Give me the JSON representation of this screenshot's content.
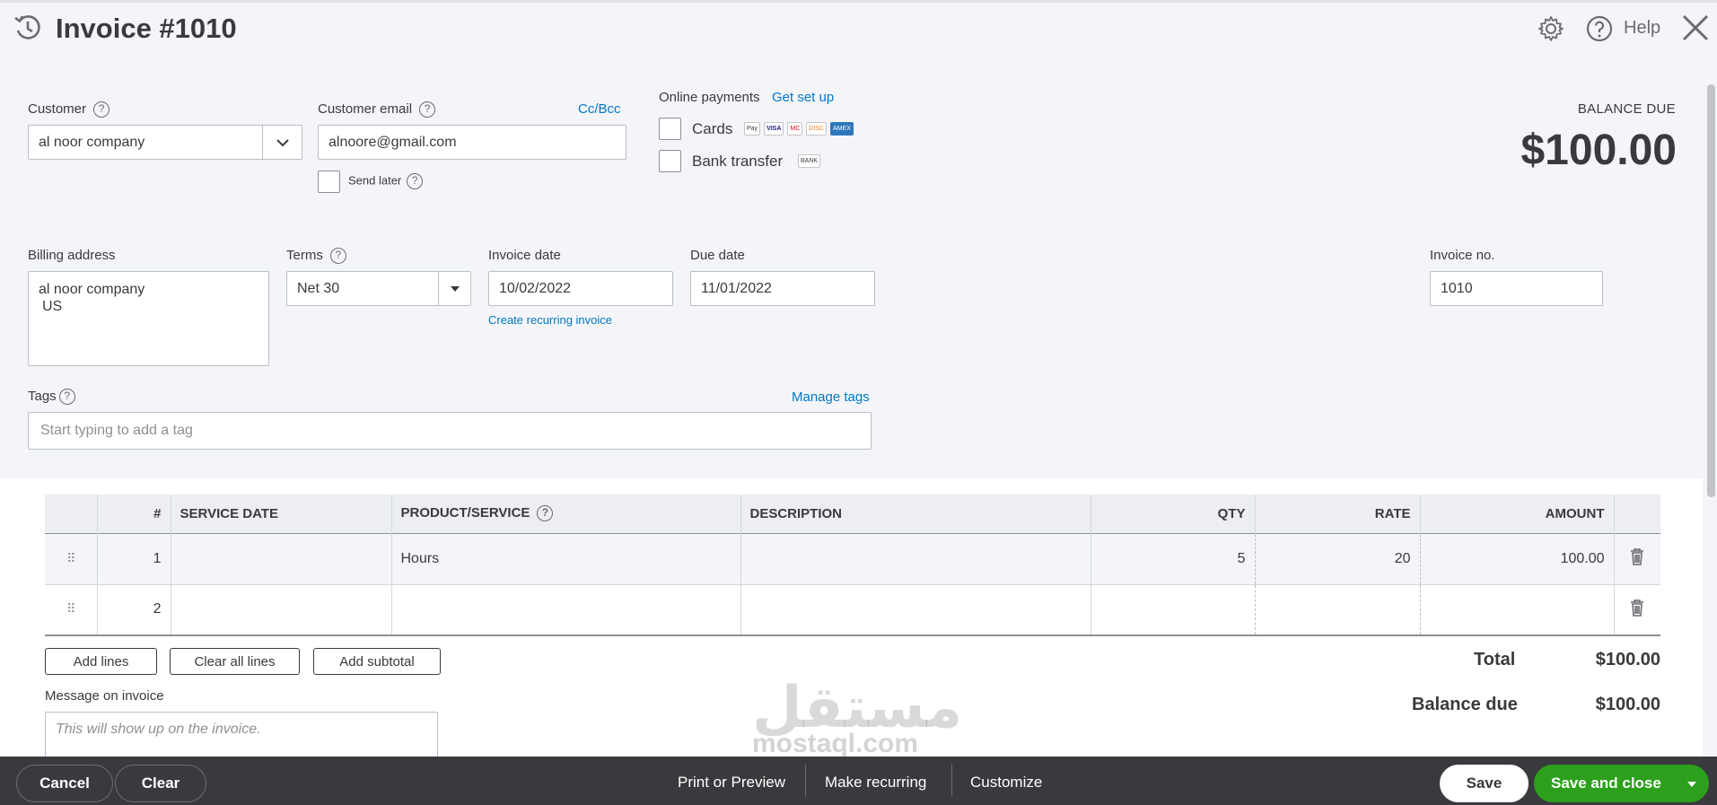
{
  "header": {
    "title": "Invoice #1010",
    "help_label": "Help"
  },
  "customer": {
    "label": "Customer",
    "value": "al noor company"
  },
  "customer_email": {
    "label": "Customer email",
    "value": "alnoore@gmail.com",
    "cc_bcc": "Cc/Bcc",
    "send_later": "Send later"
  },
  "online_payments": {
    "label": "Online payments",
    "setup_link": "Get set up",
    "cards_label": "Cards",
    "bank_label": "Bank transfer",
    "card_badges": [
      "Pay",
      "VISA",
      "MC",
      "DISC",
      "AMEX"
    ],
    "bank_badge": "BANK"
  },
  "balance": {
    "label": "BALANCE DUE",
    "amount": "$100.00"
  },
  "billing": {
    "label": "Billing address",
    "line1": "al noor company",
    "line2": "US"
  },
  "terms": {
    "label": "Terms",
    "value": "Net 30"
  },
  "invoice_date": {
    "label": "Invoice date",
    "value": "10/02/2022",
    "recurring_link": "Create recurring invoice"
  },
  "due_date": {
    "label": "Due date",
    "value": "11/01/2022"
  },
  "invoice_no": {
    "label": "Invoice no.",
    "value": "1010"
  },
  "tags": {
    "label": "Tags",
    "manage_link": "Manage tags",
    "placeholder": "Start typing to add a tag"
  },
  "table": {
    "headers": {
      "num": "#",
      "service_date": "SERVICE DATE",
      "product": "PRODUCT/SERVICE",
      "description": "DESCRIPTION",
      "qty": "QTY",
      "rate": "RATE",
      "amount": "AMOUNT"
    },
    "rows": [
      {
        "num": "1",
        "service_date": "",
        "product": "Hours",
        "description": "",
        "qty": "5",
        "rate": "20",
        "amount": "100.00"
      },
      {
        "num": "2",
        "service_date": "",
        "product": "",
        "description": "",
        "qty": "",
        "rate": "",
        "amount": ""
      }
    ]
  },
  "line_actions": {
    "add_lines": "Add lines",
    "clear_all": "Clear all lines",
    "add_subtotal": "Add subtotal"
  },
  "message": {
    "label": "Message on invoice",
    "placeholder": "This will show up on the invoice."
  },
  "totals": {
    "total_label": "Total",
    "total_value": "$100.00",
    "balance_label": "Balance due",
    "balance_value": "$100.00"
  },
  "watermark": {
    "arabic": "مستقل",
    "latin": "mostaql.com"
  },
  "footer": {
    "cancel": "Cancel",
    "clear": "Clear",
    "print_preview": "Print or Preview",
    "make_recurring": "Make recurring",
    "customize": "Customize",
    "save": "Save",
    "save_close": "Save and close"
  },
  "colors": {
    "brand_green": "#2ca01c",
    "link_blue": "#0077c5",
    "footer_bg": "#393a3d"
  }
}
